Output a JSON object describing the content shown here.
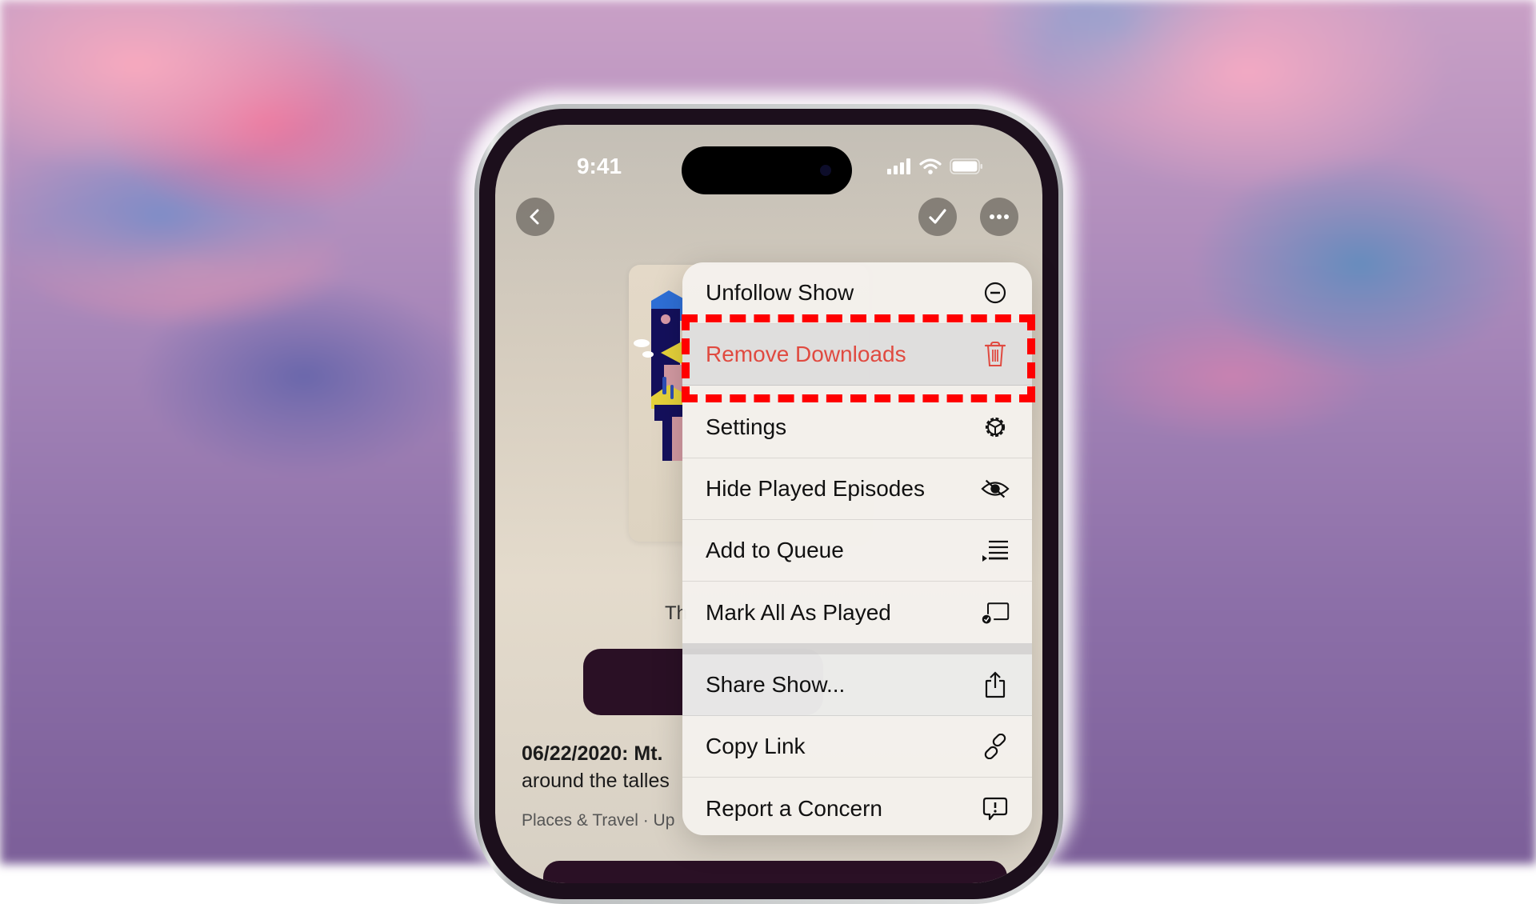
{
  "status_bar": {
    "time": "9:41",
    "icons": [
      "cellular-signal-icon",
      "wifi-icon",
      "battery-icon"
    ]
  },
  "nav": {
    "back_icon": "chevron-left-icon",
    "check_icon": "checkmark-icon",
    "more_icon": "ellipsis-icon"
  },
  "show_page": {
    "partial_title": "Th",
    "episode_title": "06/22/2020: Mt.",
    "episode_description": "around the talles",
    "episode_meta": "Places & Travel · Up"
  },
  "context_menu": {
    "items": [
      {
        "label": "Unfollow Show",
        "icon": "minus-circle-icon"
      },
      {
        "label": "Remove Downloads",
        "icon": "trash-icon",
        "destructive": true,
        "highlighted": true
      },
      {
        "label": "Settings",
        "icon": "gear-icon"
      },
      {
        "label": "Hide Played Episodes",
        "icon": "eye-slash-icon"
      },
      {
        "label": "Add to Queue",
        "icon": "queue-list-icon"
      },
      {
        "label": "Mark All As Played",
        "icon": "mark-played-icon"
      },
      {
        "label": "Share Show...",
        "icon": "share-icon"
      },
      {
        "label": "Copy Link",
        "icon": "link-icon"
      },
      {
        "label": "Report a Concern",
        "icon": "report-bubble-icon"
      }
    ]
  },
  "colors": {
    "destructive": "#e04a40",
    "highlight_annotation": "#ff0000",
    "accent_dark_button": "#2a1025"
  }
}
